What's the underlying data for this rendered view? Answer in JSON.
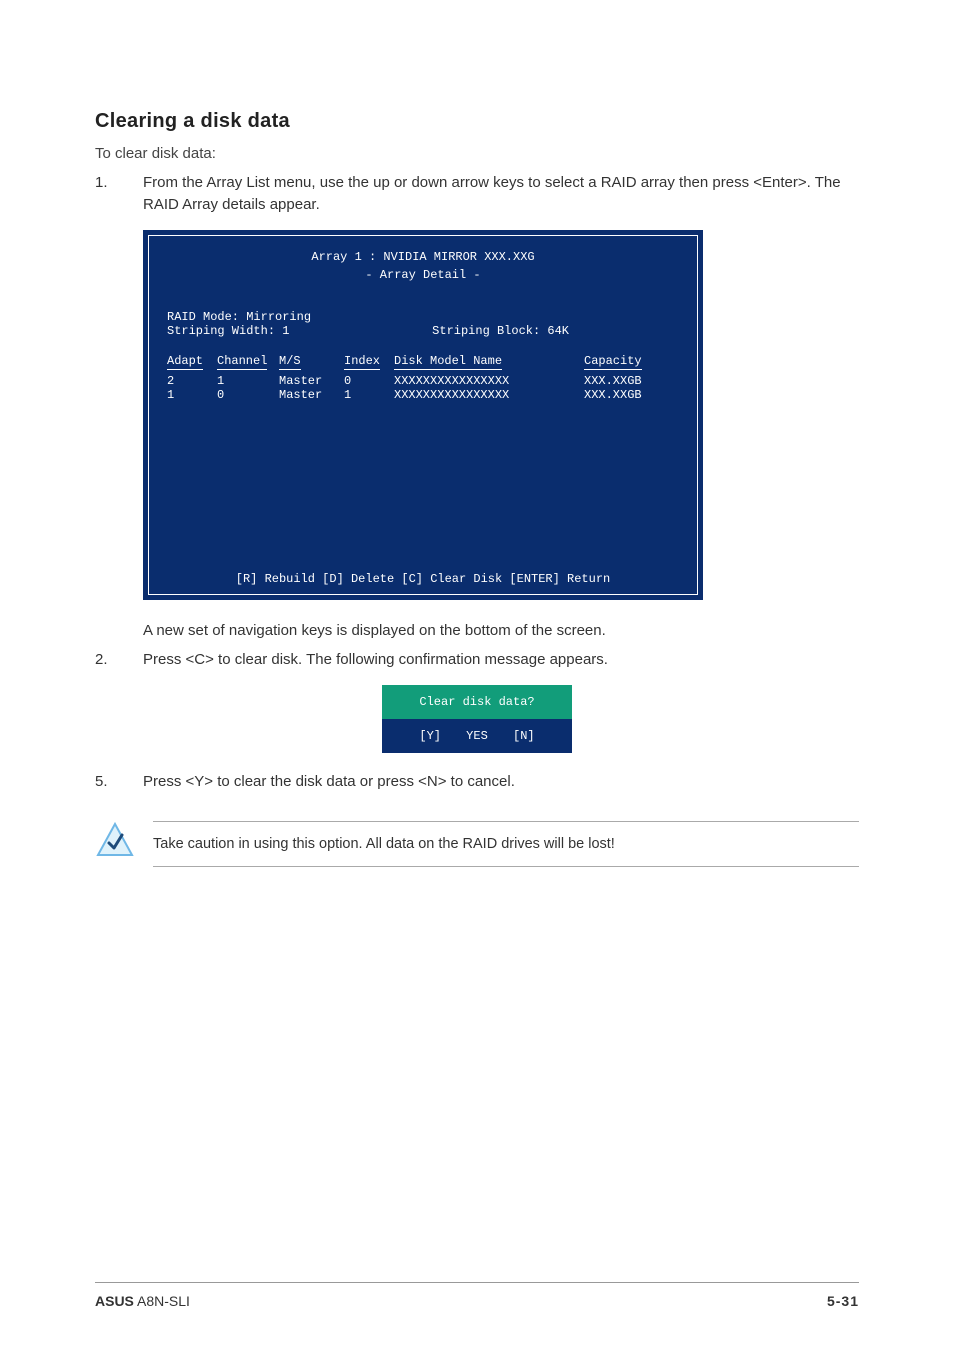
{
  "title": "Clearing a disk data",
  "intro": "To clear disk data:",
  "steps": {
    "s1_num": "1.",
    "s1_txt": "From the Array List menu, use the up or down arrow keys to select a RAID array then press <Enter>. The RAID Array details appear.",
    "s1_cont": "A new set of  navigation keys is displayed on the bottom of the screen.",
    "s2_num": "2.",
    "s2_txt": "Press <C> to clear disk. The following confirmation message appears.",
    "s5_num": "5.",
    "s5_txt": "Press <Y> to clear the disk data or press <N> to cancel."
  },
  "bios": {
    "header_line1": "Array 1 : NVIDIA MIRROR  XXX.XXG",
    "header_line2": "- Array Detail -",
    "raid_mode": "RAID Mode: Mirroring",
    "stripe_width": "Striping Width: 1",
    "stripe_block": "Striping Block: 64K",
    "headers": {
      "adapt": "Adapt",
      "channel": "Channel",
      "ms": "M/S",
      "index": "Index",
      "model": "Disk Model Name",
      "cap": "Capacity"
    },
    "rows": [
      {
        "adapt": "2",
        "channel": "1",
        "ms": "Master",
        "index": "0",
        "model": "XXXXXXXXXXXXXXXX",
        "cap": "XXX.XXGB"
      },
      {
        "adapt": "1",
        "channel": "0",
        "ms": "Master",
        "index": "1",
        "model": "XXXXXXXXXXXXXXXX",
        "cap": "XXX.XXGB"
      }
    ],
    "footer": "[R] Rebuild  [D] Delete  [C] Clear Disk  [ENTER] Return"
  },
  "dialog": {
    "title": "Clear disk data?",
    "yes": "[Y] YES",
    "no": "[N]"
  },
  "caution": "Take caution in using this option. All data on the RAID drives will be lost!",
  "footer": {
    "brand": "ASUS",
    "product": " A8N-SLI",
    "page": "5-31"
  }
}
